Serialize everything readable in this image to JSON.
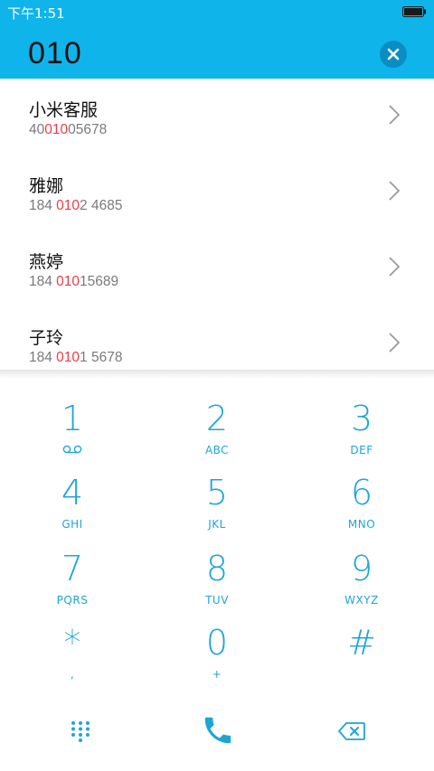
{
  "status_bar": {
    "time": "下午1:51"
  },
  "search": {
    "query": "010"
  },
  "results": [
    {
      "name": "小米客服",
      "num_pre": "40",
      "num_hl": "010",
      "num_post": "05678"
    },
    {
      "name": "雅娜",
      "num_pre": "184 ",
      "num_hl": "010",
      "num_post": "2 4685"
    },
    {
      "name": "燕婷",
      "num_pre": "184 ",
      "num_hl": "010",
      "num_post": "15689"
    },
    {
      "name": "子玲",
      "num_pre": "184 ",
      "num_hl": "010",
      "num_post": "1 5678"
    }
  ],
  "keys": [
    {
      "digit": "1",
      "letters": ""
    },
    {
      "digit": "2",
      "letters": "ABC"
    },
    {
      "digit": "3",
      "letters": "DEF"
    },
    {
      "digit": "4",
      "letters": "GHI"
    },
    {
      "digit": "5",
      "letters": "JKL"
    },
    {
      "digit": "6",
      "letters": "MNO"
    },
    {
      "digit": "7",
      "letters": "PQRS"
    },
    {
      "digit": "8",
      "letters": "TUV"
    },
    {
      "digit": "9",
      "letters": "WXYZ"
    },
    {
      "digit": "*",
      "letters": ","
    },
    {
      "digit": "0",
      "letters": "+"
    },
    {
      "digit": "#",
      "letters": ""
    }
  ],
  "colors": {
    "accent": "#0fb4ea",
    "key": "#1ea5d6",
    "highlight": "#ee3d47"
  },
  "icons": {
    "voicemail": "voicemail-icon",
    "dialpad": "dialpad-icon",
    "call": "phone-call-icon",
    "backspace": "backspace-icon",
    "clear": "clear-icon",
    "chevron": "chevron-right-icon",
    "battery": "battery-icon"
  }
}
